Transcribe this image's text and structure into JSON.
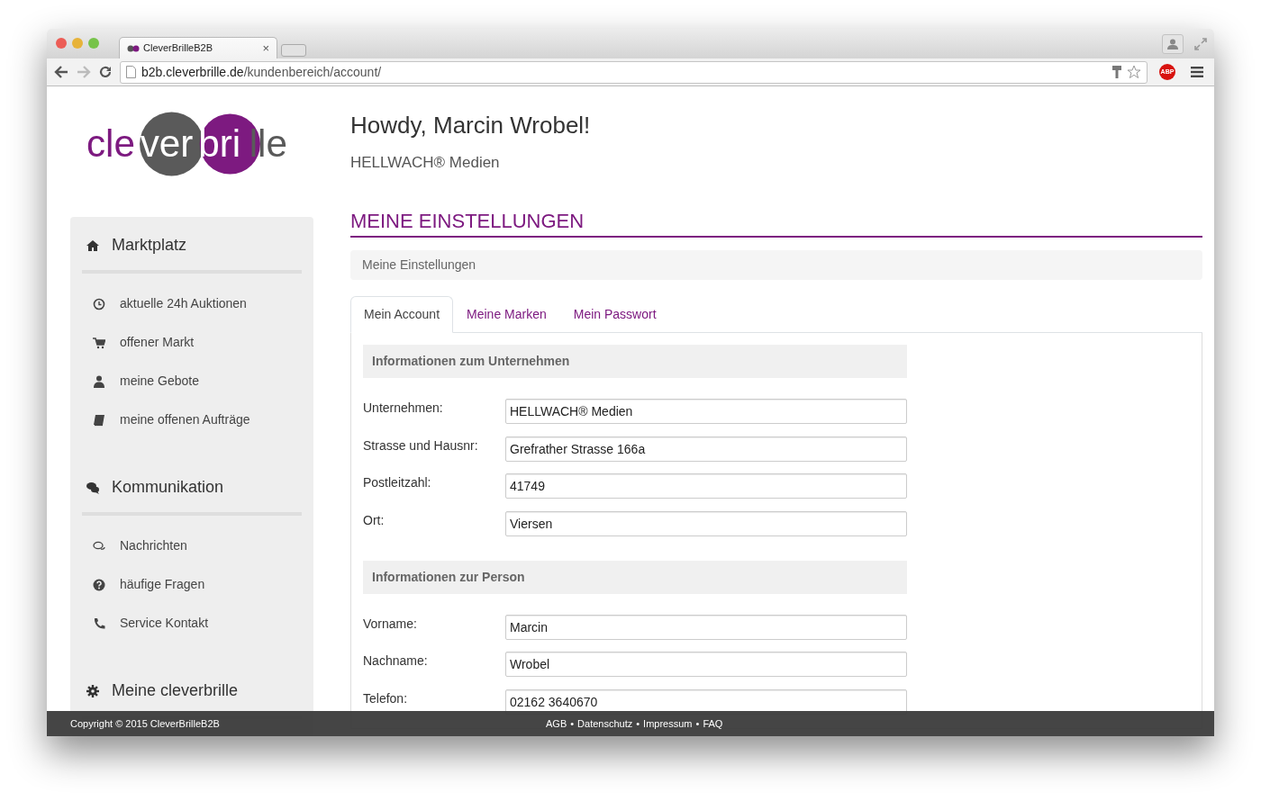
{
  "browser": {
    "tab_title": "CleverBrilleB2B",
    "tab_close": "×",
    "url_host": "b2b.cleverbrille.de",
    "url_path": "/kundenbereich/account/",
    "extension_badge": "ABP"
  },
  "logo": [
    "cle",
    "ver",
    "bri",
    "lle"
  ],
  "header": {
    "greeting": "Howdy, Marcin Wrobel!",
    "company": "HELLWACH® Medien"
  },
  "sidebar": {
    "sections": [
      {
        "title": "Marktplatz",
        "items": [
          "aktuelle 24h Auktionen",
          "offener Markt",
          "meine Gebote",
          "meine offenen Aufträge"
        ]
      },
      {
        "title": "Kommunikation",
        "items": [
          "Nachrichten",
          "häufige Fragen",
          "Service Kontakt"
        ]
      },
      {
        "title": "Meine cleverbrille"
      }
    ]
  },
  "main": {
    "section_title": "MEINE EINSTELLUNGEN",
    "breadcrumb": "Meine Einstellungen",
    "tabs": [
      {
        "label": "Mein Account",
        "selected": true
      },
      {
        "label": "Meine Marken",
        "selected": false
      },
      {
        "label": "Mein Passwort",
        "selected": false
      }
    ],
    "groups": [
      {
        "heading": "Informationen zum Unternehmen",
        "fields": [
          {
            "label": "Unternehmen:",
            "value": "HELLWACH® Medien"
          },
          {
            "label": "Strasse und Hausnr:",
            "value": "Grefrather Strasse 166a"
          },
          {
            "label": "Postleitzahl:",
            "value": "41749"
          },
          {
            "label": "Ort:",
            "value": "Viersen"
          }
        ]
      },
      {
        "heading": "Informationen zur Person",
        "fields": [
          {
            "label": "Vorname:",
            "value": "Marcin"
          },
          {
            "label": "Nachname:",
            "value": "Wrobel"
          },
          {
            "label": "Telefon:",
            "value": "02162 3640670"
          }
        ]
      }
    ]
  },
  "footer": {
    "copyright": "Copyright © 2015 CleverBrilleB2B",
    "links": [
      "AGB",
      "Datenschutz",
      "Impressum",
      "FAQ"
    ],
    "separator": "•"
  }
}
